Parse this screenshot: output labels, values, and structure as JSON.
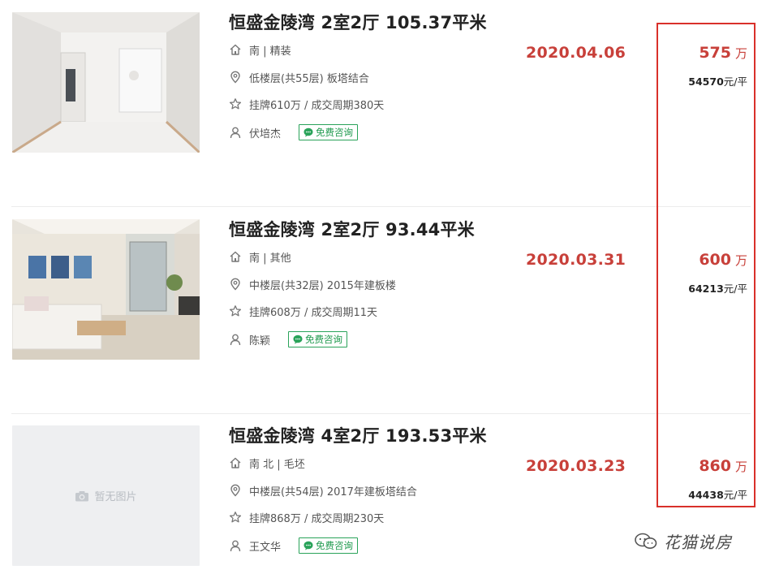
{
  "listings": [
    {
      "title": "恒盛金陵湾 2室2厅 105.37平米",
      "orientation": "南 | 精装",
      "floor": "低楼层(共55层) 板塔结合",
      "listing": "挂牌610万 / 成交周期380天",
      "agent": "伏培杰",
      "consult_label": "免费咨询",
      "date": "2020.04.06",
      "price": "575",
      "price_unit": "万",
      "unit_price": "54570",
      "unit_price_suffix": "元/平",
      "photo": "empty-living-room"
    },
    {
      "title": "恒盛金陵湾 2室2厅 93.44平米",
      "orientation": "南 | 其他",
      "floor": "中楼层(共32层) 2015年建板楼",
      "listing": "挂牌608万 / 成交周期11天",
      "agent": "陈颖",
      "consult_label": "免费咨询",
      "date": "2020.03.31",
      "price": "600",
      "price_unit": "万",
      "unit_price": "64213",
      "unit_price_suffix": "元/平",
      "photo": "furnished-living-room"
    },
    {
      "title": "恒盛金陵湾 4室2厅 193.53平米",
      "orientation": "南 北 | 毛坯",
      "floor": "中楼层(共54层) 2017年建板塔结合",
      "listing": "挂牌868万 / 成交周期230天",
      "agent": "王文华",
      "consult_label": "免费咨询",
      "date": "2020.03.23",
      "price": "860",
      "price_unit": "万",
      "unit_price": "44438",
      "unit_price_suffix": "元/平",
      "photo": "none",
      "no_photo_label": "暂无图片"
    }
  ],
  "watermark": "花猫说房",
  "colors": {
    "accent_red": "#c8403a",
    "consult_green": "#1f9a4e",
    "highlight_box": "#d9302a"
  }
}
